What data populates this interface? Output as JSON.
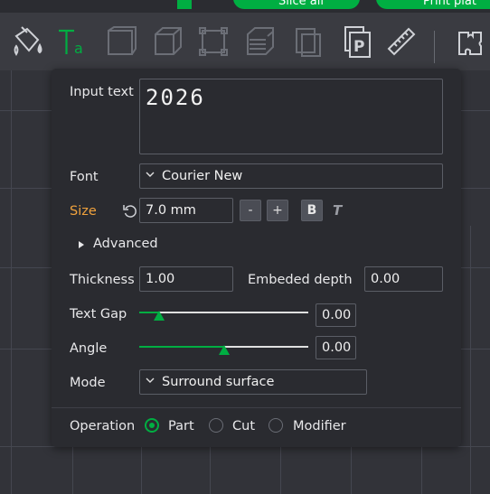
{
  "top_bar": {
    "slice_all_label": "Slice all",
    "print_plate_label": "Print plat"
  },
  "toolbar": {
    "tools": [
      "paint-bucket-icon",
      "text-tool-icon",
      "cut-plane-icon",
      "box-icon",
      "bounding-box-icon",
      "layers-icon",
      "duplicate-icon",
      "placeholder-p-icon",
      "measure-ruler-icon",
      "assembly-icon"
    ]
  },
  "panel": {
    "input_text_label": "Input text",
    "input_text_value": "2026",
    "font_label": "Font",
    "font_value": "Courier New",
    "size_label": "Size",
    "size_value": "7.0 mm",
    "minus_label": "-",
    "plus_label": "+",
    "bold_label": "B",
    "italic_label": "T",
    "advanced_label": "Advanced",
    "thickness_label": "Thickness",
    "thickness_value": "1.00",
    "embeded_depth_label": "Embeded depth",
    "embeded_depth_value": "0.00",
    "text_gap_label": "Text Gap",
    "text_gap_value": "0.00",
    "text_gap_slider_fraction": 0.12,
    "angle_label": "Angle",
    "angle_value": "0.00",
    "angle_slider_fraction": 0.5,
    "mode_label": "Mode",
    "mode_value": "Surround surface",
    "operation_label": "Operation",
    "operations": [
      {
        "label": "Part",
        "selected": true
      },
      {
        "label": "Cut",
        "selected": false
      },
      {
        "label": "Modifier",
        "selected": false
      }
    ]
  },
  "colors": {
    "accent_green": "#00ae42",
    "size_label_orange": "#f0a23d",
    "panel_bg": "#2a2b30",
    "viewport_bg": "#323339"
  }
}
